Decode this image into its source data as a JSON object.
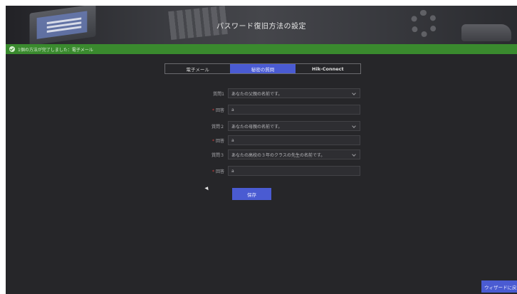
{
  "header": {
    "title": "パスワード復旧方法の設定"
  },
  "status": {
    "text": "1個の方法が完了しました：電子メール",
    "color": "#3a8a2e"
  },
  "tabs": [
    {
      "label": "電子メール",
      "active": false
    },
    {
      "label": "秘密の質問",
      "active": true
    },
    {
      "label": "Hik-Connect",
      "active": false
    }
  ],
  "form": {
    "rows": [
      {
        "label": "質問1",
        "value": "あなたの父親の名前です。",
        "type": "select",
        "required": false
      },
      {
        "label": "回答",
        "value": "a",
        "type": "input",
        "required": true
      },
      {
        "label": "質問２",
        "value": "あなたの母親の名前です。",
        "type": "select",
        "required": false
      },
      {
        "label": "回答",
        "value": "a",
        "type": "input",
        "required": true
      },
      {
        "label": "質問３",
        "value": "あなたの高校の３年のクラスの先生の名前です。",
        "type": "select",
        "required": false
      },
      {
        "label": "回答",
        "value": "a",
        "type": "input",
        "required": true
      }
    ],
    "required_mark": "*"
  },
  "actions": {
    "save_label": "保存",
    "wizard_label": "ウィザードに戻る"
  },
  "colors": {
    "accent": "#4a5bd2",
    "background": "#262629",
    "success": "#3a8a2e",
    "required": "#d04040"
  }
}
